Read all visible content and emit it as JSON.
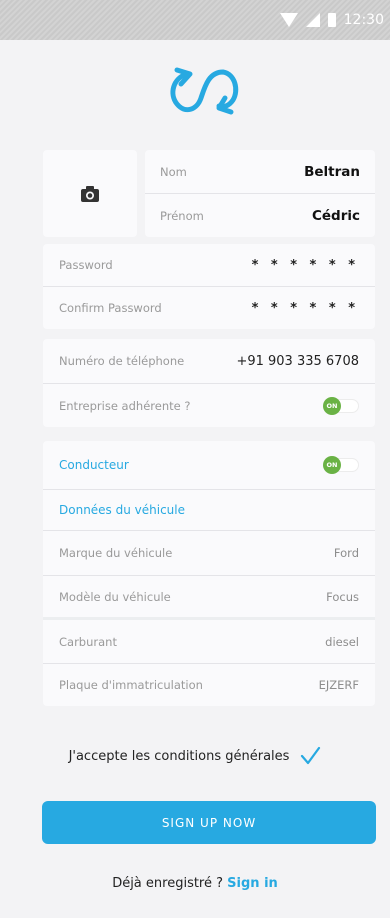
{
  "status_bar": {
    "time": "12:30",
    "icons": [
      "wifi-icon",
      "signal-icon",
      "battery-icon"
    ]
  },
  "logo": {
    "icon": "sync-logo-icon",
    "color": "#27a9e1"
  },
  "profile": {
    "photo_icon": "camera-icon"
  },
  "name": {
    "nom_label": "Nom",
    "nom_value": "Beltran",
    "prenom_label": "Prénom",
    "prenom_value": "Cédric"
  },
  "password": {
    "password_label": "Password",
    "password_value": "* * * * * *",
    "confirm_label": "Confirm Password",
    "confirm_value": "* * * * * *"
  },
  "contact": {
    "phone_label": "Numéro de téléphone",
    "phone_value": "+91 903 335 6708",
    "company_label": "Entreprise adhérente ?",
    "company_toggle": "ON"
  },
  "driver": {
    "driver_label": "Conducteur",
    "driver_toggle": "ON",
    "vehicle_section": "Données du véhicule"
  },
  "vehicle": {
    "brand_label": "Marque du véhicule",
    "brand_value": "Ford",
    "model_label": "Modèle du véhicule",
    "model_value": "Focus",
    "fuel_label": "Carburant",
    "fuel_value": "diesel",
    "plate_label": "Plaque d'immatriculation",
    "plate_value": "EJZERF"
  },
  "terms": {
    "label": "J'accepte les conditions générales",
    "checked": true
  },
  "actions": {
    "signup_label": "SIGN UP NOW",
    "already_text": "Déjà enregistré ?",
    "signin_label": "Sign in"
  },
  "colors": {
    "accent": "#27a9e1",
    "toggle_on": "#6ab245",
    "background": "#f3f3f5"
  }
}
